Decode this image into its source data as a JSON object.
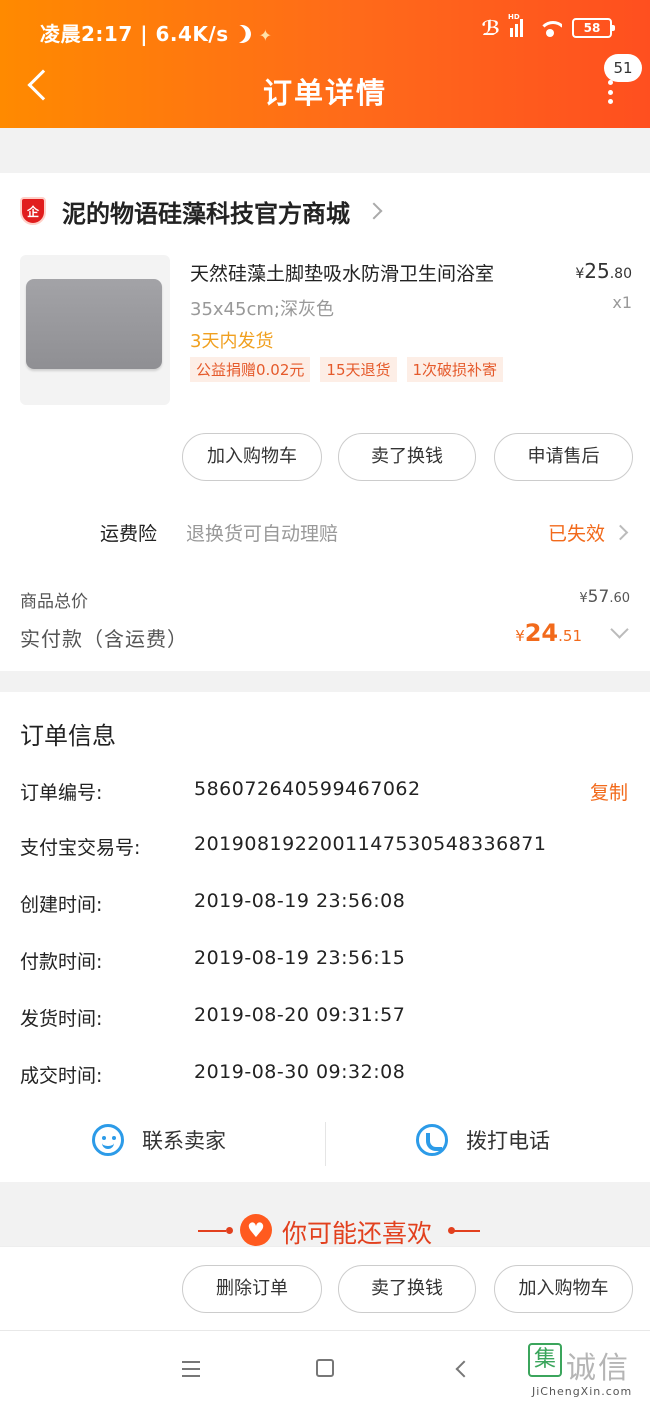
{
  "status_bar": {
    "time": "凌晨2:17 | 6.4K/s",
    "battery": "58",
    "hd": "HD"
  },
  "header": {
    "title": "订单详情",
    "badge_count": "51"
  },
  "store": {
    "name": "泥的物语硅藻科技官方商城",
    "badge_text": "企"
  },
  "product": {
    "title": "天然硅藻土脚垫吸水防滑卫生间浴室",
    "price_yen": "¥",
    "price_int": "25",
    "price_dec": ".80",
    "sku": "35x45cm;深灰色",
    "qty": "x1",
    "ship_note": "3天内发货",
    "tags": [
      "公益捐赠0.02元",
      "15天退货",
      "1次破损补寄"
    ]
  },
  "product_actions": {
    "add_to_cart": "加入购物车",
    "sell_for_cash": "卖了换钱",
    "after_sale": "申请售后"
  },
  "insurance": {
    "label": "运费险",
    "desc": "退换货可自动理赔",
    "status": "已失效"
  },
  "totals": {
    "goods_total_label": "商品总价",
    "goods_total_yen": "¥",
    "goods_total_int": "57",
    "goods_total_dec": ".60",
    "paid_label": "实付款（含运费）",
    "paid_yen": "¥",
    "paid_int": "24",
    "paid_dec": ".51"
  },
  "order_info": {
    "title": "订单信息",
    "rows": [
      {
        "label": "订单编号:",
        "value": "586072640599467062"
      },
      {
        "label": "支付宝交易号:",
        "value": "2019081922001147530548336871"
      },
      {
        "label": "创建时间:",
        "value": "2019-08-19 23:56:08"
      },
      {
        "label": "付款时间:",
        "value": "2019-08-19 23:56:15"
      },
      {
        "label": "发货时间:",
        "value": "2019-08-20 09:31:57"
      },
      {
        "label": "成交时间:",
        "value": "2019-08-30 09:32:08"
      }
    ],
    "copy_label": "复制"
  },
  "contact": {
    "seller": "联系卖家",
    "call": "拨打电话"
  },
  "recommend": {
    "title": "你可能还喜欢"
  },
  "bottom_actions": {
    "delete_order": "删除订单",
    "sell_for_cash": "卖了换钱",
    "add_to_cart": "加入购物车"
  },
  "watermark": {
    "logo_char": "集",
    "text": "诚信",
    "sub": "JiChengXin.com"
  },
  "colors": {
    "header_gradient_start": "#ff8a00",
    "header_gradient_end": "#ff4f1f",
    "accent_orange": "#f26a1b",
    "ship_note": "#f0a020",
    "contact_blue": "#2c9be8"
  },
  "icons": [
    "back-icon",
    "more-icon",
    "store-badge-icon",
    "chevron-right-icon",
    "chevron-down-icon",
    "face-icon",
    "phone-icon",
    "heart-icon",
    "menu-icon",
    "home-icon",
    "nav-back-icon"
  ]
}
